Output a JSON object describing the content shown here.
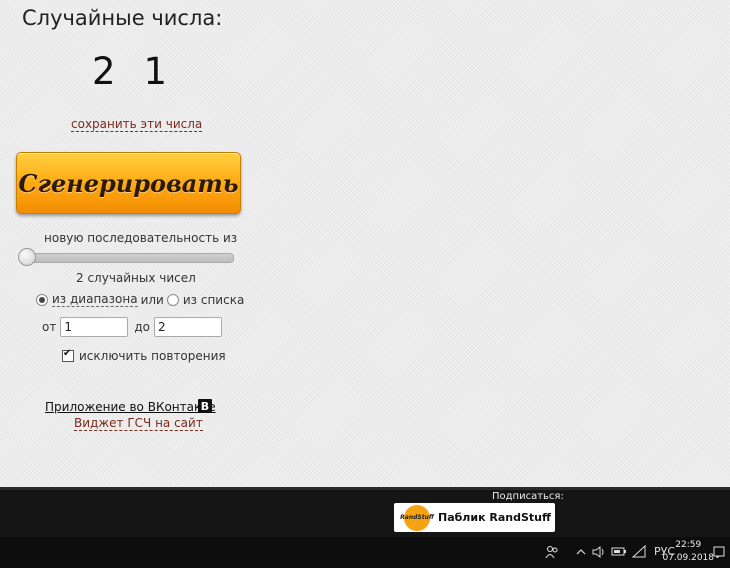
{
  "title": "Случайные числа:",
  "numbers": [
    "2",
    "1"
  ],
  "save_link": "сохранить эти числа",
  "generate_button": "Сгенерировать",
  "sequence_label": "новую последовательность из",
  "slider": {
    "value_fraction": 0.0
  },
  "count_label": "2 случайных чисел",
  "mode": {
    "range_label": "из диапазона",
    "or": "или",
    "list_label": "из списка",
    "selected": "range"
  },
  "range": {
    "from_label": "от",
    "from_value": "1",
    "to_label": "до",
    "to_value": "2"
  },
  "exclude_repeats": {
    "label": "исключить повторения",
    "checked": true
  },
  "links": {
    "vk_app": "Приложение во ВКонтакте",
    "vk_icon": "В",
    "widget": "Виджет ГСЧ на сайт"
  },
  "footer": {
    "subscribe": "Подписаться:",
    "public_name": "Паблик RandStuff",
    "logo_text": "RandStuff"
  },
  "taskbar": {
    "time": "22:59",
    "date": "07.09.2018",
    "lang": "РУС"
  },
  "icons": [
    "people-icon",
    "chevron-up-icon",
    "volume-icon",
    "battery-icon",
    "network-icon",
    "notification-icon"
  ]
}
